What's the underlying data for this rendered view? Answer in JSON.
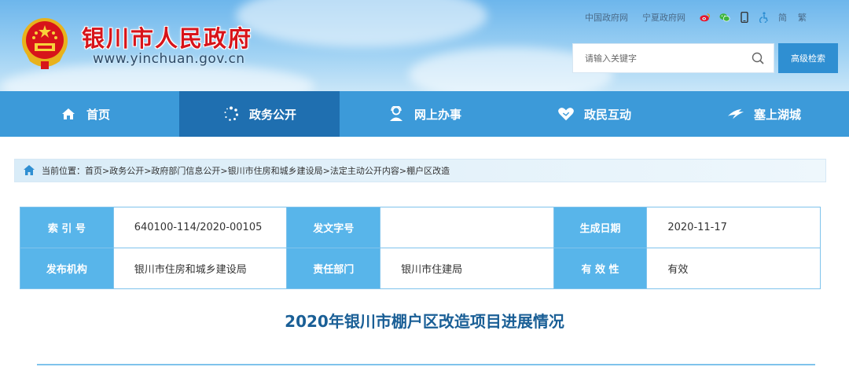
{
  "header": {
    "site_title": "银川市人民政府",
    "site_url": "www.yinchuan.gov.cn",
    "top_links": [
      "中国政府网",
      "宁夏政府网"
    ],
    "icons": [
      "weibo-icon",
      "wechat-icon",
      "mobile-icon",
      "accessibility-icon"
    ],
    "lang_simplified": "简",
    "lang_traditional": "繁",
    "search_placeholder": "请输入关键字",
    "advanced_search_label": "高级检索"
  },
  "nav": {
    "items": [
      {
        "label": "首页",
        "icon": "home-icon"
      },
      {
        "label": "政务公开",
        "icon": "dots-circle-icon",
        "active": true
      },
      {
        "label": "网上办事",
        "icon": "service-person-icon"
      },
      {
        "label": "政民互动",
        "icon": "heart-hands-icon"
      },
      {
        "label": "塞上湖城",
        "icon": "bird-icon"
      }
    ]
  },
  "breadcrumb": {
    "prefix": "当前位置：",
    "path": "首页>政务公开>政府部门信息公开>银川市住房和城乡建设局>法定主动公开内容>棚户区改造"
  },
  "info": {
    "index_label": "索 引 号",
    "index_value": "640100-114/2020-00105",
    "doc_no_label": "发文字号",
    "doc_no_value": "",
    "date_label": "生成日期",
    "date_value": "2020-11-17",
    "org_label": "发布机构",
    "org_value": "银川市住房和城乡建设局",
    "dept_label": "责任部门",
    "dept_value": "银川市住建局",
    "validity_label": "有 效 性",
    "validity_value": "有效"
  },
  "doc_title": "2020年银川市棚户区改造项目进展情况",
  "colors": {
    "nav_bg": "#3c9ad9",
    "nav_active": "#1f6fb0",
    "label_cell": "#58b5ea",
    "title_red": "#d7141a",
    "doc_title": "#1a5f96"
  }
}
